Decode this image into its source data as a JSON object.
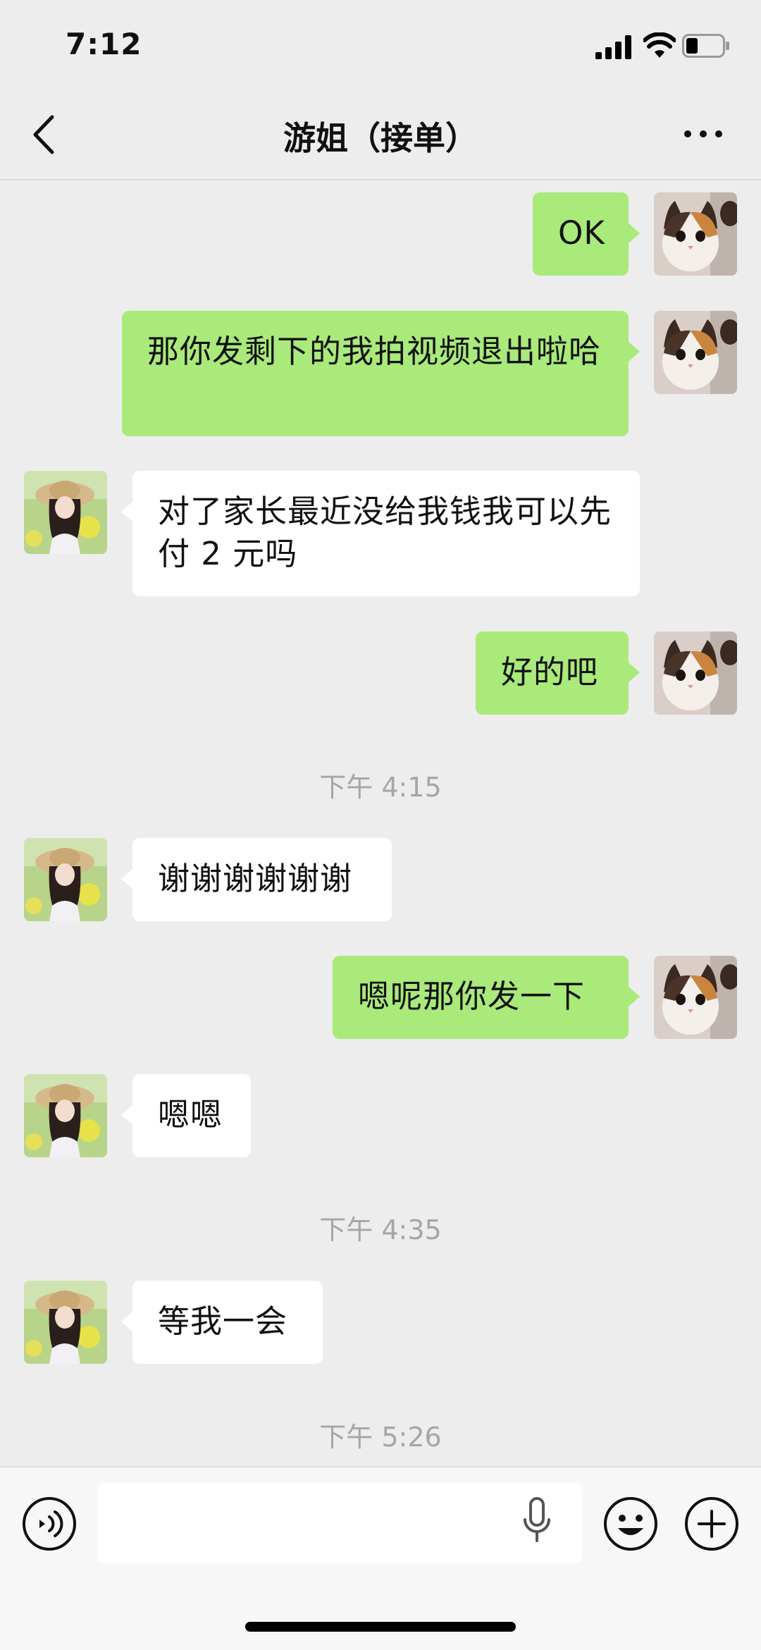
{
  "status_bar": {
    "time": "7:12"
  },
  "header": {
    "title": "游姐（接单）"
  },
  "messages": [
    {
      "side": "me",
      "text": "OK"
    },
    {
      "side": "me",
      "text": "那你发剩下的我拍视频退出啦哈"
    },
    {
      "side": "them",
      "text": "对了家长最近没给我钱我可以先付 2 元吗"
    },
    {
      "side": "me",
      "text": "好的吧"
    },
    {
      "type": "time",
      "text": "下午 4:15"
    },
    {
      "side": "them",
      "text": "谢谢谢谢谢谢"
    },
    {
      "side": "me",
      "text": "嗯呢那你发一下"
    },
    {
      "side": "them",
      "text": "嗯嗯"
    },
    {
      "type": "time",
      "text": "下午 4:35"
    },
    {
      "side": "them",
      "text": "等我一会"
    },
    {
      "type": "time",
      "text": "下午 5:26"
    }
  ],
  "icons": {
    "back": "chevron-left-icon",
    "more": "more-dots-icon",
    "voice": "voice-icon",
    "mic": "microphone-icon",
    "emoji": "emoji-icon",
    "plus": "plus-icon"
  },
  "colors": {
    "background": "#ededed",
    "my_bubble": "#a9ea7a",
    "their_bubble": "#ffffff",
    "timestamp": "#a6a6a6"
  }
}
